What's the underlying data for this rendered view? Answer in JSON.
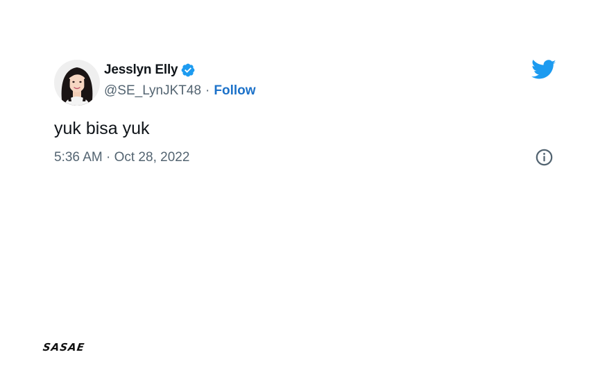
{
  "tweet": {
    "author": {
      "display_name": "Jesslyn Elly",
      "handle": "@SE_LynJKT48",
      "verified": true,
      "avatar_icon": "profile-photo"
    },
    "separator": "·",
    "follow_label": "Follow",
    "text": "yuk bisa yuk",
    "timestamp": "5:36 AM · Oct 28, 2022",
    "icons": {
      "verified": "verified-badge-icon",
      "platform": "twitter-bird-icon",
      "info": "info-icon"
    }
  },
  "watermark": {
    "brand": "SASAE"
  },
  "colors": {
    "follow_link": "#1d72c9",
    "verified_badge": "#1d9bf0",
    "twitter_logo": "#1d9bf0",
    "muted_text": "#536471",
    "primary_text": "#0f1419"
  }
}
